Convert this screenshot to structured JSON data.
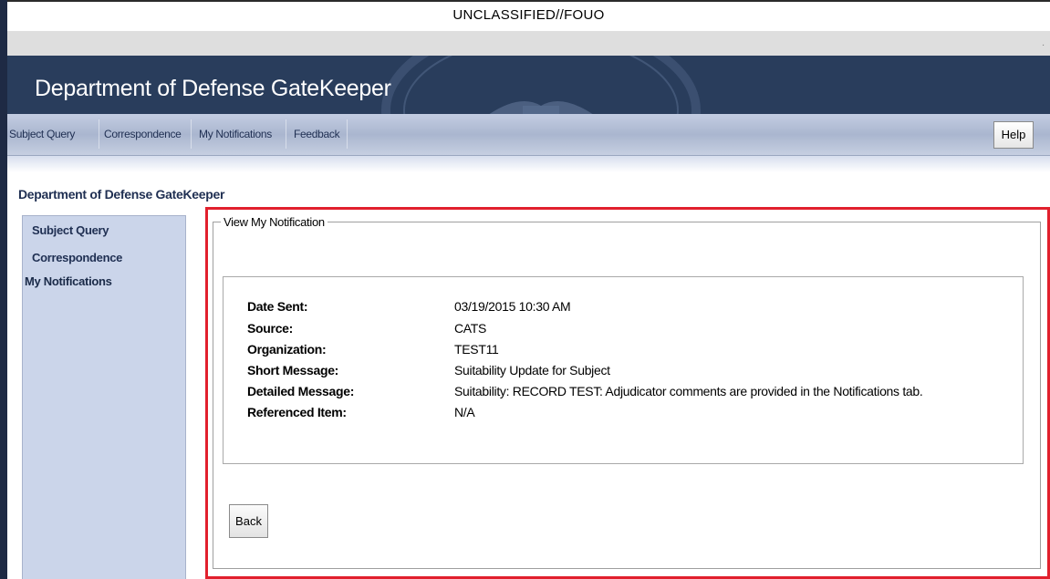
{
  "classification": "UNCLASSIFIED//FOUO",
  "banner": {
    "title": "Department of Defense GateKeeper"
  },
  "nav": {
    "tabs": [
      "Subject Query",
      "Correspondence",
      "My Notifications",
      "Feedback"
    ],
    "help_label": "Help"
  },
  "page_heading": "Department of Defense GateKeeper",
  "sidebar": {
    "items": [
      "Subject Query",
      "Correspondence",
      "My Notifications"
    ],
    "active": "My Notifications"
  },
  "notification": {
    "legend": "View My Notification",
    "fields": [
      {
        "label": "Date Sent:",
        "value": "03/19/2015 10:30 AM"
      },
      {
        "label": "Source:",
        "value": "CATS"
      },
      {
        "label": "Organization:",
        "value": "TEST11"
      },
      {
        "label": "Short Message:",
        "value": "Suitability Update for Subject"
      },
      {
        "label": "Detailed Message:",
        "value": "Suitability: RECORD TEST: Adjudicator comments are provided in the Notifications tab."
      },
      {
        "label": "Referenced Item:",
        "value": "N/A"
      }
    ],
    "back_label": "Back"
  },
  "colors": {
    "banner_bg": "#293d5c",
    "nav_bg": "#b4bfd6",
    "sidebar_bg": "#cbd5ea",
    "highlight": "#e1202d"
  }
}
